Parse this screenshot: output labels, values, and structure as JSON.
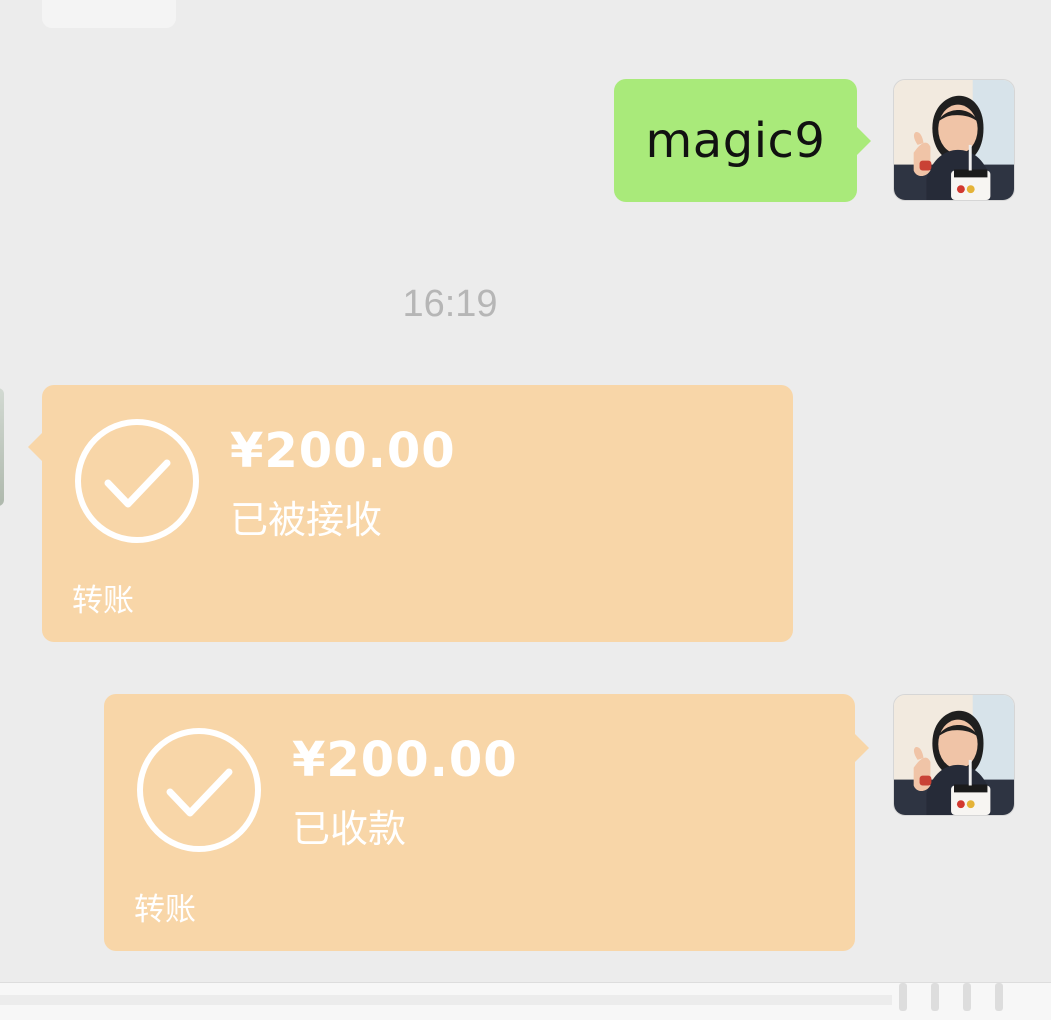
{
  "messages": {
    "text_message": "magic9",
    "timestamp": "16:19",
    "transfer_received": {
      "amount": "¥200.00",
      "status": "已被接收",
      "footer": "转账"
    },
    "transfer_collected": {
      "amount": "¥200.00",
      "status": "已收款",
      "footer": "转账"
    }
  },
  "colors": {
    "chat_background": "#ececec",
    "text_bubble": "#a9ea7a",
    "transfer_card": "#f8d6a8",
    "timestamp_text": "#b6b6b6"
  },
  "icons": {
    "transfer_status": "check-circle-icon"
  }
}
